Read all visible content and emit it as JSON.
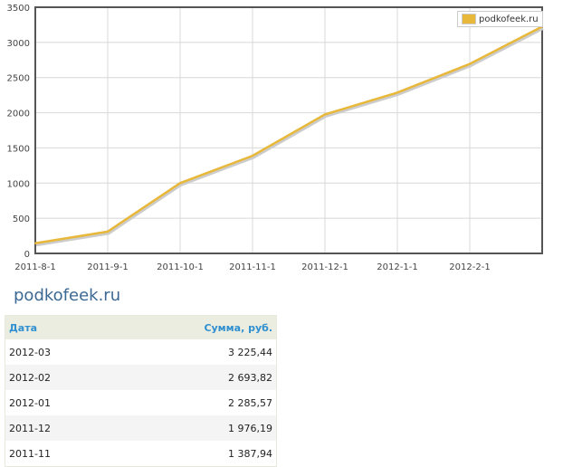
{
  "chart_data": {
    "type": "line",
    "x": [
      "2011-8-1",
      "2011-9-1",
      "2011-10-1",
      "2011-11-1",
      "2011-12-1",
      "2012-1-1",
      "2012-2-1",
      "2012-3-1"
    ],
    "x_tick_labels": [
      "2011-8-1",
      "2011-9-1",
      "2011-10-1",
      "2011-11-1",
      "2011-12-1",
      "2012-1-1",
      "2012-2-1"
    ],
    "series": [
      {
        "name": "podkofeek.ru",
        "values": [
          145,
          310,
          1000,
          1388,
          1976,
          2286,
          2694,
          3225
        ],
        "color": "#e8b83a"
      }
    ],
    "ylim": [
      0,
      3500
    ],
    "y_ticks": [
      0,
      500,
      1000,
      1500,
      2000,
      2500,
      3000,
      3500
    ],
    "grid": true,
    "legend": "top-right"
  },
  "title": "podkofeek.ru",
  "table": {
    "headers": [
      "Дата",
      "Сумма, руб."
    ],
    "rows": [
      [
        "2012-03",
        "3 225,44"
      ],
      [
        "2012-02",
        "2 693,82"
      ],
      [
        "2012-01",
        "2 285,57"
      ],
      [
        "2011-12",
        "1 976,19"
      ],
      [
        "2011-11",
        "1 387,94"
      ]
    ]
  }
}
